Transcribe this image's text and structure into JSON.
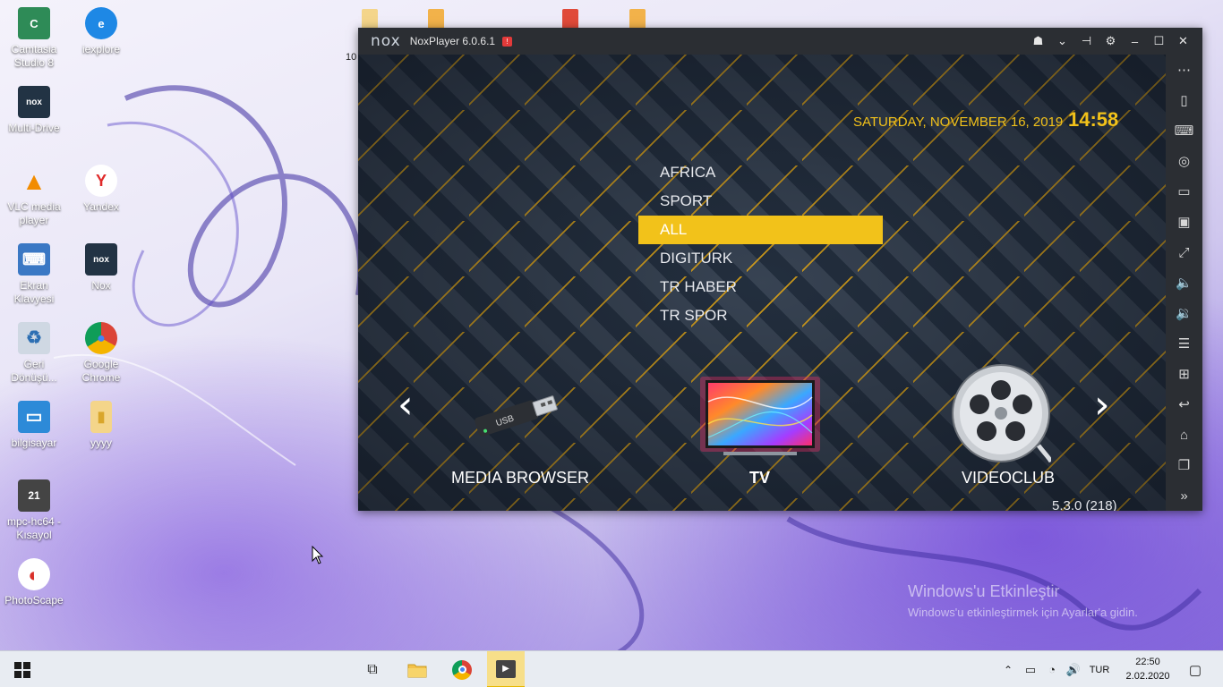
{
  "desktop": {
    "icons": [
      {
        "name": "camtasia-icon",
        "label": "Camtasia Studio 8",
        "color": "#2e8b57",
        "glyph": "C"
      },
      {
        "name": "iexplore-icon",
        "label": "iexplore",
        "color": "#1e88e5",
        "glyph": "e"
      },
      {
        "name": "multi-drive-icon",
        "label": "Multi-Drive",
        "color": "#223344",
        "glyph": "nox"
      },
      {
        "name": "vlc-icon",
        "label": "VLC media player",
        "color": "#f28c00",
        "glyph": "▲"
      },
      {
        "name": "yandex-icon",
        "label": "Yandex",
        "color": "#ffffff",
        "glyph": "Y"
      },
      {
        "name": "ekran-klavyesi-icon",
        "label": "Ekran Klavyesi",
        "color": "#3a78c4",
        "glyph": "⌨"
      },
      {
        "name": "nox-icon",
        "label": "Nox",
        "color": "#223344",
        "glyph": "nox"
      },
      {
        "name": "recycle-bin-icon",
        "label": "Geri Dönüşü...",
        "color": "#cfd8e3",
        "glyph": "♻"
      },
      {
        "name": "google-chrome-icon",
        "label": "Google Chrome",
        "color": "#db4437",
        "glyph": "●"
      },
      {
        "name": "computer-icon",
        "label": "bilgisayar",
        "color": "#2d8ad8",
        "glyph": "▭"
      },
      {
        "name": "folder-icon",
        "label": "yyyy",
        "color": "#f4d58a",
        "glyph": "▮"
      },
      {
        "name": "mpc-hc-icon",
        "label": "mpc-hc64 - Kısayol",
        "color": "#444",
        "glyph": "21"
      },
      {
        "name": "photoscape-icon",
        "label": "PhotoScape",
        "color": "#fff",
        "glyph": "◐"
      }
    ],
    "watermark_title": "Windows'u Etkinleştir",
    "watermark_sub": "Windows'u etkinleştirmek için Ayarlar'a gidin.",
    "partial_label": "10"
  },
  "nox": {
    "logo": "nox",
    "title": "NoxPlayer 6.0.6.1",
    "colors": {
      "accent": "#f2c21a",
      "titlebar": "#2b2e33"
    }
  },
  "app": {
    "date": "SATURDAY, NOVEMBER 16, 2019",
    "time": "14:58",
    "categories": [
      "AFRICA",
      "SPORT",
      "ALL",
      "DIGITURK",
      "TR HABER",
      "TR SPOR"
    ],
    "selected_category": "ALL",
    "tiles": {
      "media": "MEDIA BROWSER",
      "tv": "TV",
      "video": "VIDEOCLUB"
    },
    "usb_text": "USB",
    "version": "5.3.0 (218)"
  },
  "taskbar": {
    "language": "TUR",
    "time": "22:50",
    "date": "2.02.2020"
  }
}
